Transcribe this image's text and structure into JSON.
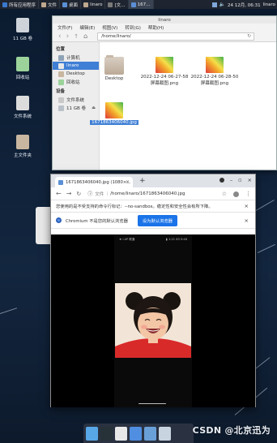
{
  "top_panel": {
    "tasks": [
      {
        "label": "所有应用程序",
        "color": "#3a78d0",
        "active": false
      },
      {
        "label": "文件",
        "color": "#bfa98f",
        "active": false
      },
      {
        "label": "桌面",
        "color": "#5b8fd6",
        "active": false
      },
      {
        "label": "linaro",
        "color": "#bfa98f",
        "active": false
      },
      {
        "label": "[文…",
        "color": "#7a7a7a",
        "active": false
      },
      {
        "label": "167…",
        "color": "#5b8fd6",
        "active": true
      }
    ],
    "tray_icons": [
      "network-icon",
      "speaker-icon",
      "battery-icon"
    ],
    "clock": "24 12月, 06:31",
    "user": "linaro"
  },
  "desktop_icons": [
    {
      "name": "disk-icon",
      "label": "11 GB 卷",
      "color": "#cfd4da"
    },
    {
      "name": "trash-icon",
      "label": "回收站",
      "color": "#9bd39b"
    },
    {
      "name": "filesystem-icon",
      "label": "文件系统",
      "color": "#dcdcdc"
    },
    {
      "name": "home-folder-icon",
      "label": "主文件夹",
      "color": "#c8b6a0"
    }
  ],
  "file_manager": {
    "title": "linaro",
    "menu": [
      "文件(F)",
      "编辑(E)",
      "视图(V)",
      "转到(G)",
      "帮助(H)"
    ],
    "address": "/home/linaro/",
    "sidebar": {
      "places_heading": "位置",
      "places": [
        {
          "label": "计算机",
          "icon": "computer-icon",
          "selected": false
        },
        {
          "label": "linaro",
          "icon": "home-icon",
          "selected": true
        },
        {
          "label": "Desktop",
          "icon": "desktop-folder-icon",
          "selected": false
        },
        {
          "label": "回收站",
          "icon": "trash-icon",
          "selected": false
        }
      ],
      "devices_heading": "设备",
      "devices": [
        {
          "label": "文件系统",
          "icon": "filesystem-icon",
          "eject": false
        },
        {
          "label": "11 GB 卷",
          "icon": "disk-icon",
          "eject": true
        }
      ]
    },
    "files": [
      {
        "label": "Desktop",
        "kind": "folder",
        "selected": false
      },
      {
        "label": "2022-12-24 06-27-58 屏幕截图.png",
        "kind": "image",
        "selected": false
      },
      {
        "label": "2022-12-24 06-28-50 屏幕截图.png",
        "kind": "image",
        "selected": false
      },
      {
        "label": "1671863406040.jpg",
        "kind": "image",
        "selected": true
      }
    ]
  },
  "chromium": {
    "tab_title": "1671863406040.jpg (1080×…",
    "url_scheme": "文件",
    "url_path": "/home/linaro/1671863406040.jpg",
    "warning": "您使用的是不受支持的命令行标记：--no-sandbox。稳定性和安全性会有所下降。",
    "default_prompt": "Chromium 不是您的默认浏览器",
    "default_button": "设为默认浏览器",
    "image_status_left": "★☆AP 联通",
    "image_status_right": "▮ 1:21 63 9:46",
    "accent": "#1a73e8"
  },
  "taskbar": [
    {
      "name": "show-desktop-icon",
      "color": "#58a8e8"
    },
    {
      "name": "terminal-icon",
      "color": "#263238"
    },
    {
      "name": "file-manager-icon",
      "color": "#e8e8e8"
    },
    {
      "name": "browser-icon",
      "color": "#4f8ee0"
    },
    {
      "name": "search-app-icon",
      "color": "#6aa0d8"
    },
    {
      "name": "folder-app-icon",
      "color": "#c8d4e0"
    }
  ],
  "watermark": "CSDN @北京迅为"
}
